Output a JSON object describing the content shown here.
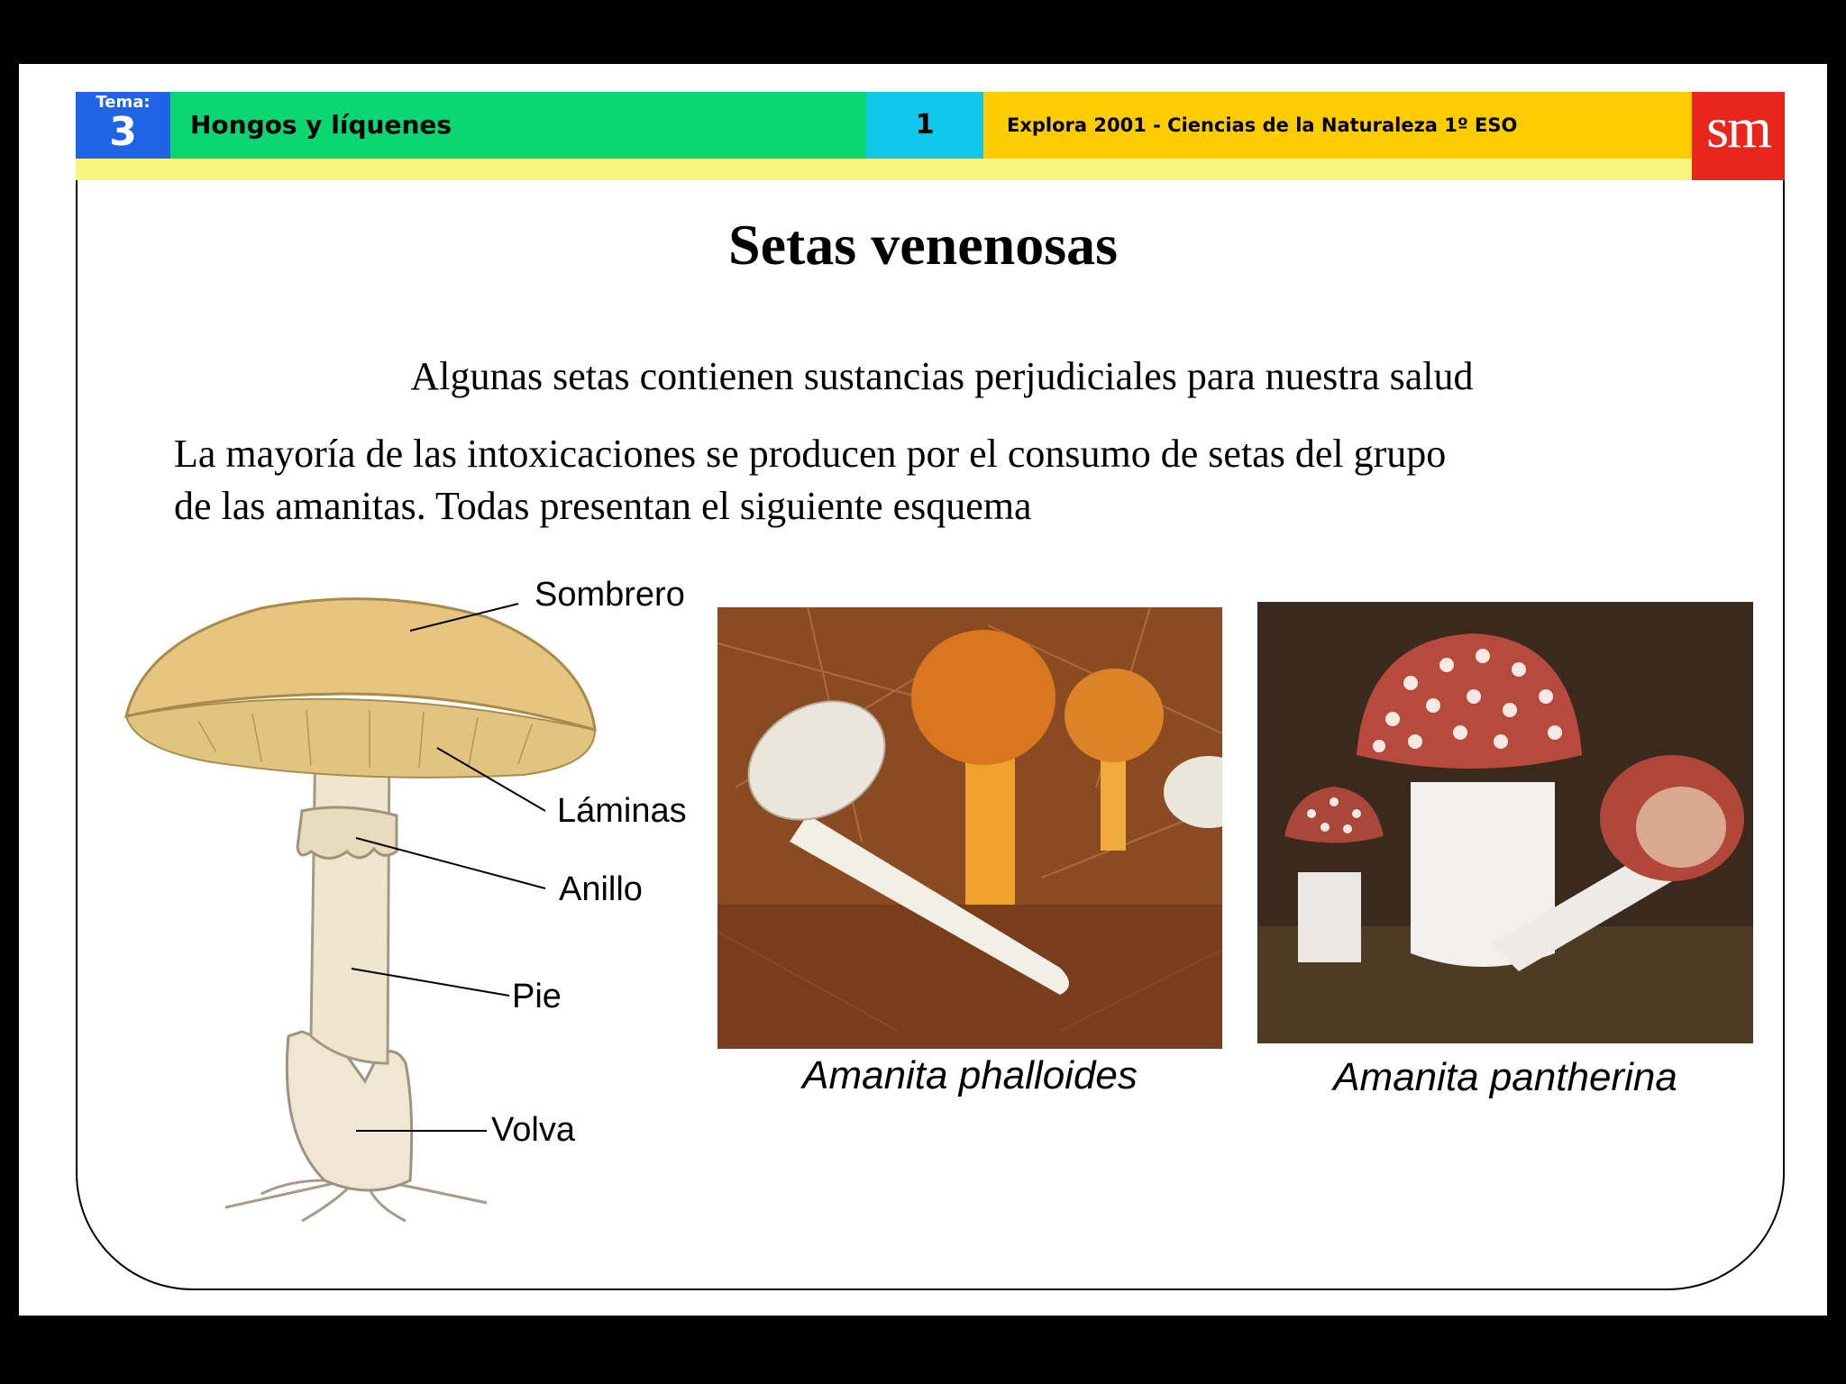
{
  "header": {
    "tema_label": "Tema:",
    "tema_number": "3",
    "topic": "Hongos y líquenes",
    "page_number": "1",
    "book": "Explora 2001 - Ciencias de la Naturaleza 1º ESO",
    "logo": "sm"
  },
  "title": "Setas venenosas",
  "subtitle": "Algunas setas contienen sustancias perjudiciales para nuestra salud",
  "body_lines": [
    "La mayoría de las intoxicaciones se producen por el consumo de setas del grupo",
    "de las amanitas. Todas presentan el siguiente esquema"
  ],
  "diagram": {
    "labels": {
      "sombrero": "Sombrero",
      "laminas": "Láminas",
      "anillo": "Anillo",
      "pie": "Pie",
      "volva": "Volva"
    }
  },
  "photos": [
    {
      "caption": "Amanita phalloides"
    },
    {
      "caption": "Amanita pantherina"
    }
  ],
  "colors": {
    "tema_blue": "#1f63e6",
    "topic_green": "#0ad672",
    "page_cyan": "#12c8ea",
    "book_yellow": "#ffcc00",
    "strip_yellow": "#f6f47a",
    "logo_red": "#e8261c"
  }
}
